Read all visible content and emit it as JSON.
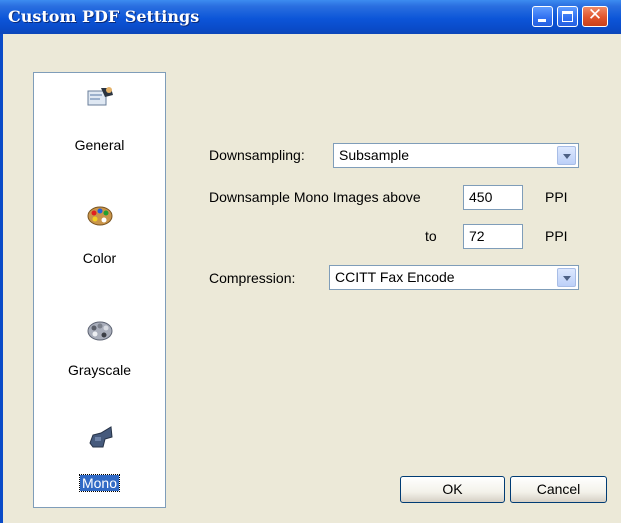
{
  "window": {
    "title": "Custom PDF Settings",
    "controls": {
      "minimize": "minimize",
      "maximize": "maximize",
      "close": "✕"
    }
  },
  "categories": [
    {
      "label": "General",
      "icon": "general-settings-icon",
      "selected": false
    },
    {
      "label": "Color",
      "icon": "color-palette-icon",
      "selected": false
    },
    {
      "label": "Grayscale",
      "icon": "grayscale-palette-icon",
      "selected": false
    },
    {
      "label": "Mono",
      "icon": "mono-icon",
      "selected": true
    }
  ],
  "form": {
    "downsampling_label": "Downsampling:",
    "downsampling_value": "Subsample",
    "downsample_above_label": "Downsample Mono Images above",
    "downsample_above_value": "450",
    "ppi_unit_1": "PPI",
    "to_label": "to",
    "to_value": "72",
    "ppi_unit_2": "PPI",
    "compression_label": "Compression:",
    "compression_value": "CCITT Fax Encode"
  },
  "buttons": {
    "ok": "OK",
    "cancel": "Cancel"
  }
}
